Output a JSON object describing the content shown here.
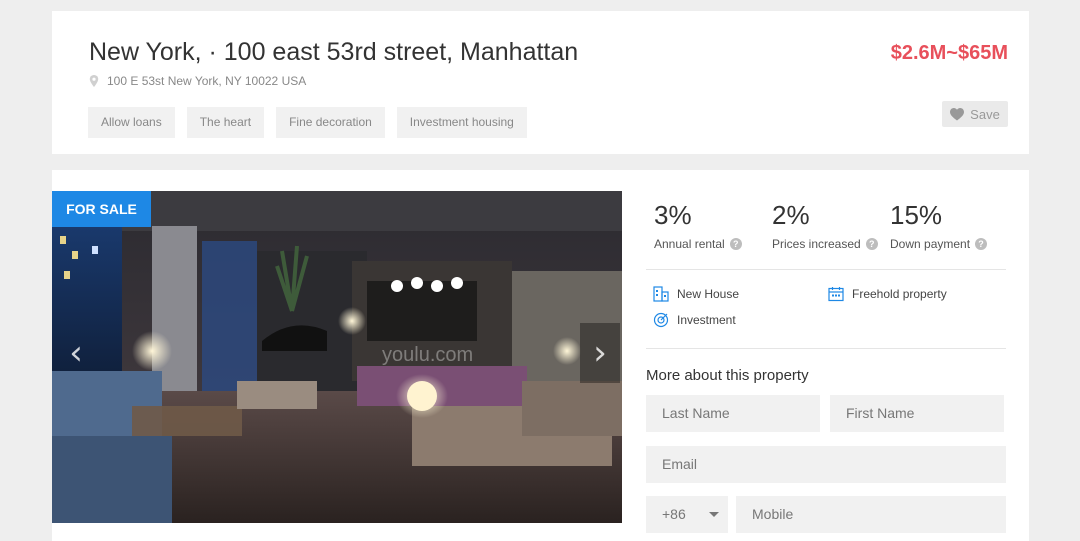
{
  "header": {
    "title": "New York, · 100 east 53rd street, Manhattan",
    "address": "100 E 53st New York, NY 10022 USA",
    "tags": [
      "Allow loans",
      "The heart",
      "Fine decoration",
      "Investment housing"
    ],
    "price": "$2.6M~$65M",
    "save_label": "Save"
  },
  "gallery": {
    "badge": "FOR SALE",
    "watermark": "youlu.com"
  },
  "stats": [
    {
      "value": "3%",
      "label": "Annual rental"
    },
    {
      "value": "2%",
      "label": "Prices increased"
    },
    {
      "value": "15%",
      "label": "Down payment"
    }
  ],
  "features": [
    {
      "label": "New House",
      "icon": "building-icon"
    },
    {
      "label": "Freehold property",
      "icon": "calendar-icon"
    },
    {
      "label": "Investment",
      "icon": "target-icon"
    }
  ],
  "contact_form": {
    "title": "More about this property",
    "last_name_placeholder": "Last Name",
    "first_name_placeholder": "First Name",
    "email_placeholder": "Email",
    "country_code": "+86",
    "mobile_placeholder": "Mobile"
  },
  "colors": {
    "accent_blue": "#1e88e5",
    "price_red": "#e8505b",
    "background": "#eeeeee"
  }
}
